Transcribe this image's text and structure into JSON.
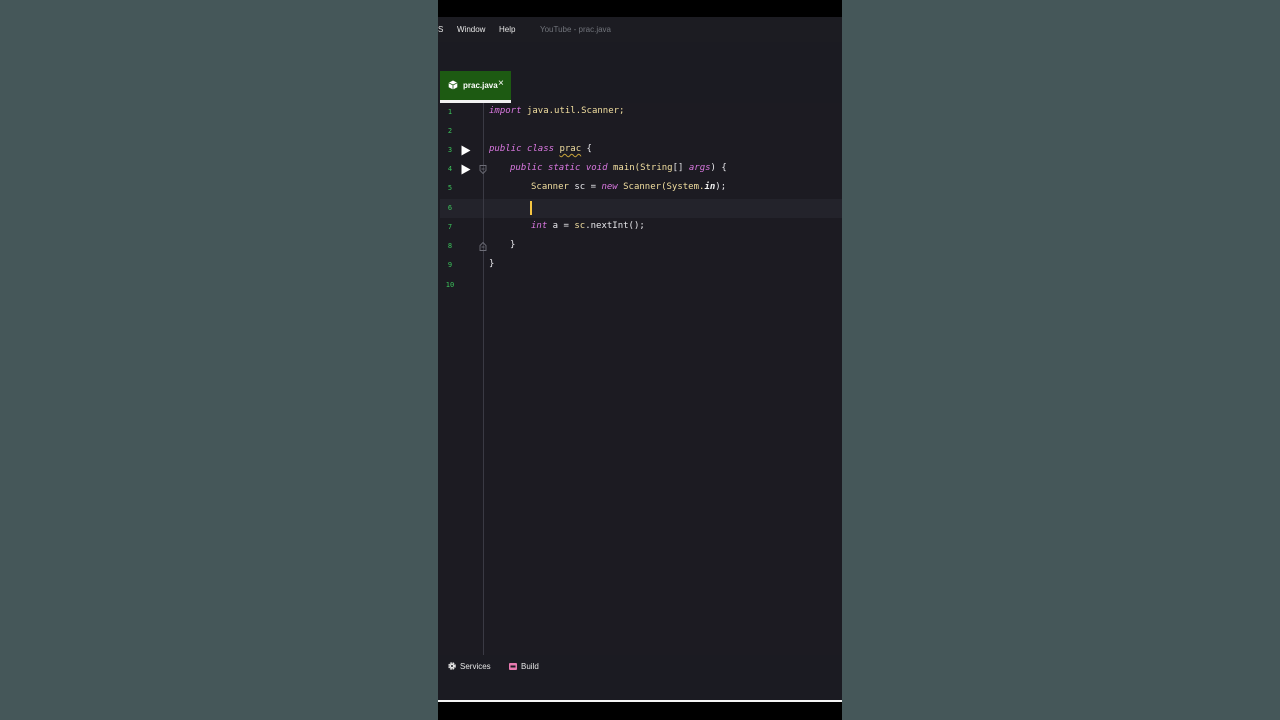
{
  "menu": {
    "items": [
      "S",
      "Window",
      "Help"
    ],
    "window_title": "YouTube - prac.java"
  },
  "tab": {
    "label": "prac.java",
    "close": "×"
  },
  "editor": {
    "line_numbers": [
      "1",
      "2",
      "3",
      "4",
      "5",
      "6",
      "7",
      "8",
      "9",
      "10"
    ],
    "lines": {
      "l1": {
        "kw": "import",
        "rest": " java.util.Scanner;"
      },
      "l3": {
        "kw1": "public",
        "kw2": "class",
        "name": "prac",
        "rest": " {"
      },
      "l4": {
        "kw1": "public",
        "kw2": "static",
        "kw3": "void",
        "name": "main(",
        "type": "String",
        "mid": "[] ",
        "param": "args",
        "rest": ") {"
      },
      "l5": {
        "type": "Scanner",
        "var": " sc = ",
        "kw": "new",
        "call": " Scanner(",
        "sys": "System.",
        "field": "in",
        "rest": ");"
      },
      "l7": {
        "kw": "int",
        "var": " a = ",
        "obj": "sc",
        "rest": ".nextInt();"
      },
      "l8": {
        "text": "}"
      },
      "l9": {
        "text": "}"
      }
    }
  },
  "bottombar": {
    "services": "Services",
    "build": "Build"
  },
  "colors": {
    "tab_active": "#1d5a12",
    "keyword": "#d978e0",
    "type": "#f2dfa0",
    "line_number": "#3bc45b",
    "caret": "#f5c542",
    "editor_bg": "#1c1b22",
    "outer_bg": "#435557"
  },
  "icons": {
    "tab_file": "java-file-icon",
    "run": "run-icon",
    "fold": "fold-icon",
    "services": "gear-icon",
    "build": "build-icon"
  }
}
